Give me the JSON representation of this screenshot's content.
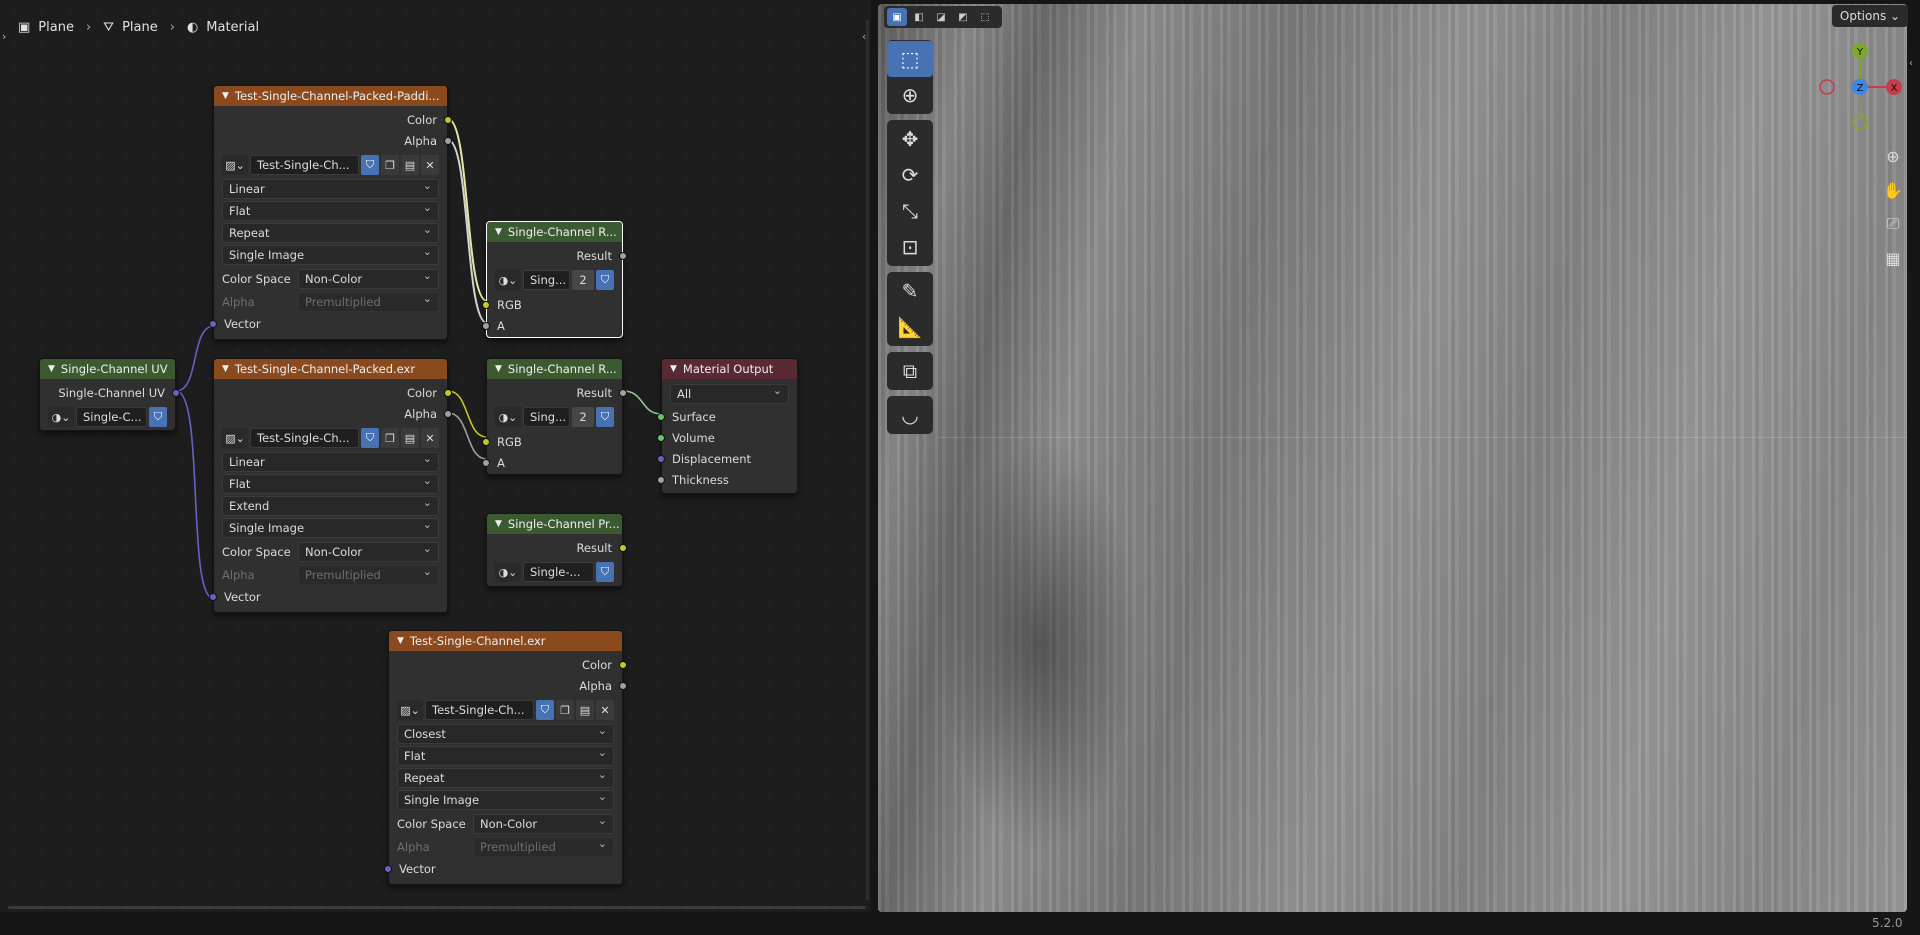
{
  "breadcrumb": [
    {
      "label": "Plane",
      "icon": "object-icon"
    },
    {
      "label": "Plane",
      "icon": "mesh-icon"
    },
    {
      "label": "Material",
      "icon": "material-icon"
    }
  ],
  "nodes": {
    "tex_padding": {
      "title": "Test-Single-Channel-Packed-Paddi...",
      "out_color": "Color",
      "out_alpha": "Alpha",
      "image_name": "Test-Single-Ch...",
      "interpolation": "Linear",
      "projection": "Flat",
      "extension": "Repeat",
      "source": "Single Image",
      "color_space_label": "Color Space",
      "color_space": "Non-Color",
      "alpha_label": "Alpha",
      "alpha_mode": "Premultiplied",
      "in_vector": "Vector"
    },
    "tex_packed": {
      "title": "Test-Single-Channel-Packed.exr",
      "out_color": "Color",
      "out_alpha": "Alpha",
      "image_name": "Test-Single-Ch...",
      "interpolation": "Linear",
      "projection": "Flat",
      "extension": "Extend",
      "source": "Single Image",
      "color_space_label": "Color Space",
      "color_space": "Non-Color",
      "alpha_label": "Alpha",
      "alpha_mode": "Premultiplied",
      "in_vector": "Vector"
    },
    "tex_single": {
      "title": "Test-Single-Channel.exr",
      "out_color": "Color",
      "out_alpha": "Alpha",
      "image_name": "Test-Single-Ch...",
      "interpolation": "Closest",
      "projection": "Flat",
      "extension": "Repeat",
      "source": "Single Image",
      "color_space_label": "Color Space",
      "color_space": "Non-Color",
      "alpha_label": "Alpha",
      "alpha_mode": "Premultiplied",
      "in_vector": "Vector"
    },
    "uv": {
      "title": "Single-Channel UV",
      "out_uv": "Single-Channel UV",
      "group_name": "Single-C..."
    },
    "group1": {
      "title": "Single-Channel R...",
      "out_result": "Result",
      "group_name": "Sing...",
      "users": "2",
      "in_rgb": "RGB",
      "in_a": "A"
    },
    "group2": {
      "title": "Single-Channel R...",
      "out_result": "Result",
      "group_name": "Sing...",
      "users": "2",
      "in_rgb": "RGB",
      "in_a": "A"
    },
    "group3": {
      "title": "Single-Channel Pr...",
      "out_result": "Result",
      "group_name": "Single-..."
    },
    "output": {
      "title": "Material Output",
      "target": "All",
      "in_surface": "Surface",
      "in_volume": "Volume",
      "in_displacement": "Displacement",
      "in_thickness": "Thickness"
    }
  },
  "viewport": {
    "options_label": "Options",
    "version": "5.2.0",
    "gizmo": {
      "y": "Y",
      "z": "Z",
      "x": "X"
    }
  },
  "colors": {
    "texture_header": "#8a4a1d",
    "group_header": "#3c5a30",
    "output_header": "#5a2a33",
    "socket_color": "#c7c729",
    "socket_vector": "#6363c7",
    "socket_shader": "#63c763",
    "accent": "#4772b3"
  }
}
